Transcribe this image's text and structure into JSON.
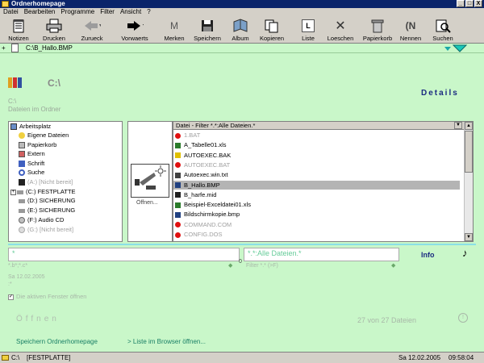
{
  "window": {
    "title": "Ordnerhomepage",
    "buttons": [
      "_",
      "□",
      "X"
    ]
  },
  "menu": [
    "Datei",
    "Bearbeiten",
    "Programme",
    "Filter",
    "Ansicht",
    "?"
  ],
  "toolbar": [
    {
      "label": "Notizen",
      "icon": "notepad-icon"
    },
    {
      "label": "Drucken",
      "icon": "printer-icon"
    },
    {
      "label": "Zurueck",
      "icon": "back-arrow-icon"
    },
    {
      "label": "Vorwaerts",
      "icon": "forward-arrow-icon"
    },
    {
      "label": "Merken",
      "icon": "bookmark-icon"
    },
    {
      "label": "Speichern",
      "icon": "floppy-icon"
    },
    {
      "label": "Album",
      "icon": "album-icon"
    },
    {
      "label": "Kopieren",
      "icon": "copy-icon"
    },
    {
      "label": "Liste",
      "icon": "list-icon"
    },
    {
      "label": "Loeschen",
      "icon": "delete-icon"
    },
    {
      "label": "Papierkorb",
      "icon": "recycle-bin-icon"
    },
    {
      "label": "Nennen",
      "icon": "rename-icon"
    },
    {
      "label": "Suchen",
      "icon": "search-icon"
    }
  ],
  "address": {
    "path": "C:\\B_Hallo.BMP"
  },
  "header": {
    "drive": "C:\\",
    "details_link": "Details",
    "subline1": "C:\\",
    "subline2": "Dateien im Ordner"
  },
  "tree": [
    {
      "label": "Arbeitsplatz",
      "icon": "computer-icon",
      "dim": false
    },
    {
      "label": "Eigene Dateien",
      "icon": "folder-icon",
      "dim": false
    },
    {
      "label": "Papierkorb",
      "icon": "recycle-bin-icon",
      "dim": false
    },
    {
      "label": "Extern",
      "icon": "extern-icon",
      "dim": false
    },
    {
      "label": "Schrift",
      "icon": "font-icon",
      "dim": false
    },
    {
      "label": "Suche",
      "icon": "search-icon",
      "dim": false
    },
    {
      "label": "(A:) [Nicht bereit]",
      "icon": "floppy-drive-icon",
      "dim": true
    },
    {
      "label": "(C:) FESTPLATTE",
      "icon": "hard-drive-icon",
      "dim": false
    },
    {
      "label": "(D:) SICHERUNG",
      "icon": "hard-drive-icon",
      "dim": false
    },
    {
      "label": "(E:) SICHERUNG",
      "icon": "hard-drive-icon",
      "dim": false
    },
    {
      "label": "(F:) Audio CD",
      "icon": "cd-icon",
      "dim": false
    },
    {
      "label": "(G:) [Nicht bereit]",
      "icon": "cd-icon",
      "dim": true
    }
  ],
  "preview": {
    "label": "Öffnen..."
  },
  "filelist": {
    "header": "Datei - Filter *.*:Alle Dateien.*",
    "files": [
      {
        "name": "1.BAT",
        "color": "#e01010",
        "dim": true,
        "selected": false
      },
      {
        "name": "A_Tabelle01.xls",
        "color": "#2a7a2a",
        "dim": false,
        "selected": false
      },
      {
        "name": "AUTOEXEC.BAK",
        "color": "#e0c000",
        "dim": false,
        "selected": false
      },
      {
        "name": "AUTOEXEC.BAT",
        "color": "#e01010",
        "dim": true,
        "selected": false
      },
      {
        "name": "Autoexec.win.txt",
        "color": "#404040",
        "dim": false,
        "selected": false
      },
      {
        "name": "B_Hallo.BMP",
        "color": "#204080",
        "dim": false,
        "selected": true
      },
      {
        "name": "B_harfe.mid",
        "color": "#202020",
        "dim": false,
        "selected": false
      },
      {
        "name": "Beispiel-Exceldatei01.xls",
        "color": "#2a7a2a",
        "dim": false,
        "selected": false
      },
      {
        "name": "Bildschirmkopie.bmp",
        "color": "#204080",
        "dim": false,
        "selected": false
      },
      {
        "name": "COMMAND.COM",
        "color": "#e01010",
        "dim": true,
        "selected": false
      },
      {
        "name": "CONFIG.DOS",
        "color": "#e01010",
        "dim": true,
        "selected": false
      }
    ]
  },
  "inputs": {
    "name_value": "*",
    "filter_value": "*.*:Alle Dateien.*",
    "name_hint": "*.b*;*.c*",
    "filter_hint": "Filter *.* (>F)",
    "counter": "0"
  },
  "info": {
    "link": "Info",
    "date": "Sa 12.02.2005",
    "placeholder": ":*"
  },
  "checkbox": {
    "label": "Die aktiven Fenster öffnen"
  },
  "actions": {
    "open": "Öffnen",
    "count": "27 von 27 Dateien",
    "save_homepage": "Speichern  Ordnerhomepage",
    "open_browser": "> Liste im Browser öffnen..."
  },
  "status": {
    "drive": "C:\\",
    "label": "[FESTPLATTE]",
    "date": "Sa 12.02.2005",
    "time": "09:58:04"
  }
}
